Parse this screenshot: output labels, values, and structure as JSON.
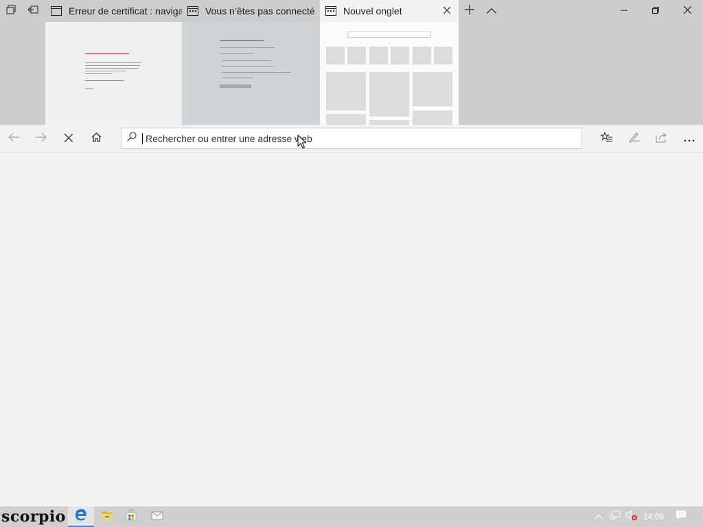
{
  "tabs": [
    {
      "title": "Erreur de certificat : navigat",
      "favicon": "page-icon",
      "active": false
    },
    {
      "title": "Vous n’êtes pas connecté",
      "favicon": "tab-page-icon",
      "active": false
    },
    {
      "title": "Nouvel onglet",
      "favicon": "tab-page-icon",
      "active": true
    }
  ],
  "tab_strip_buttons": {
    "set_aside": "tabs-aside-icon",
    "restore": "set-aside-restore-icon",
    "new_tab": "plus-icon",
    "hide_previews": "chevron-up-icon"
  },
  "window_controls": [
    "minimize-icon",
    "restore-icon",
    "close-icon"
  ],
  "address_bar": {
    "placeholder": "Rechercher ou entrer une adresse web",
    "value": ""
  },
  "nav_buttons": [
    "back-arrow-icon",
    "forward-arrow-icon",
    "stop-icon",
    "home-icon"
  ],
  "toolbar_buttons": [
    "favorites-icon",
    "pen-icon",
    "share-icon",
    "more-icon"
  ],
  "taskbar": {
    "start_label": "scorpio",
    "apps": [
      "edge-icon",
      "file-explorer-icon",
      "store-icon",
      "mail-icon"
    ],
    "tray": [
      "chevron-up-icon",
      "network-icon",
      "volume-muted-icon"
    ],
    "clock": "14:05",
    "notifications": "action-center-icon"
  },
  "colors": {
    "accent": "#3a8ee6",
    "edge_blue": "#1e7bd4",
    "error_red": "#c0392b"
  }
}
